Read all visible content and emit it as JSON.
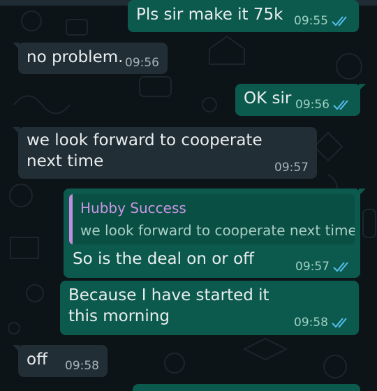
{
  "messages": [
    {
      "direction": "out",
      "text": "Pls sir make it 75k",
      "time": "09:55",
      "ticks": "read"
    },
    {
      "direction": "in",
      "text": "no problem.",
      "time": "09:56"
    },
    {
      "direction": "out",
      "text": "OK sir",
      "time": "09:56",
      "ticks": "read"
    },
    {
      "direction": "in",
      "text": "we look forward to cooperate next time",
      "time": "09:57"
    },
    {
      "direction": "out",
      "quote": {
        "author": "Hubby Success",
        "text": "we look forward to cooperate next time"
      },
      "text": "So is the deal on or off",
      "time": "09:57",
      "ticks": "read"
    },
    {
      "direction": "out",
      "text": "Because I have started it this morning",
      "time": "09:58",
      "ticks": "read"
    },
    {
      "direction": "in",
      "text": "off",
      "time": "09:58"
    }
  ],
  "colors": {
    "background": "#0d1418",
    "incoming_bubble": "#222e35",
    "outgoing_bubble": "#0c5a4d",
    "read_tick": "#53bdeb",
    "quote_author": "#c996e6"
  },
  "icons": {
    "read_receipt": "double-check-icon"
  }
}
